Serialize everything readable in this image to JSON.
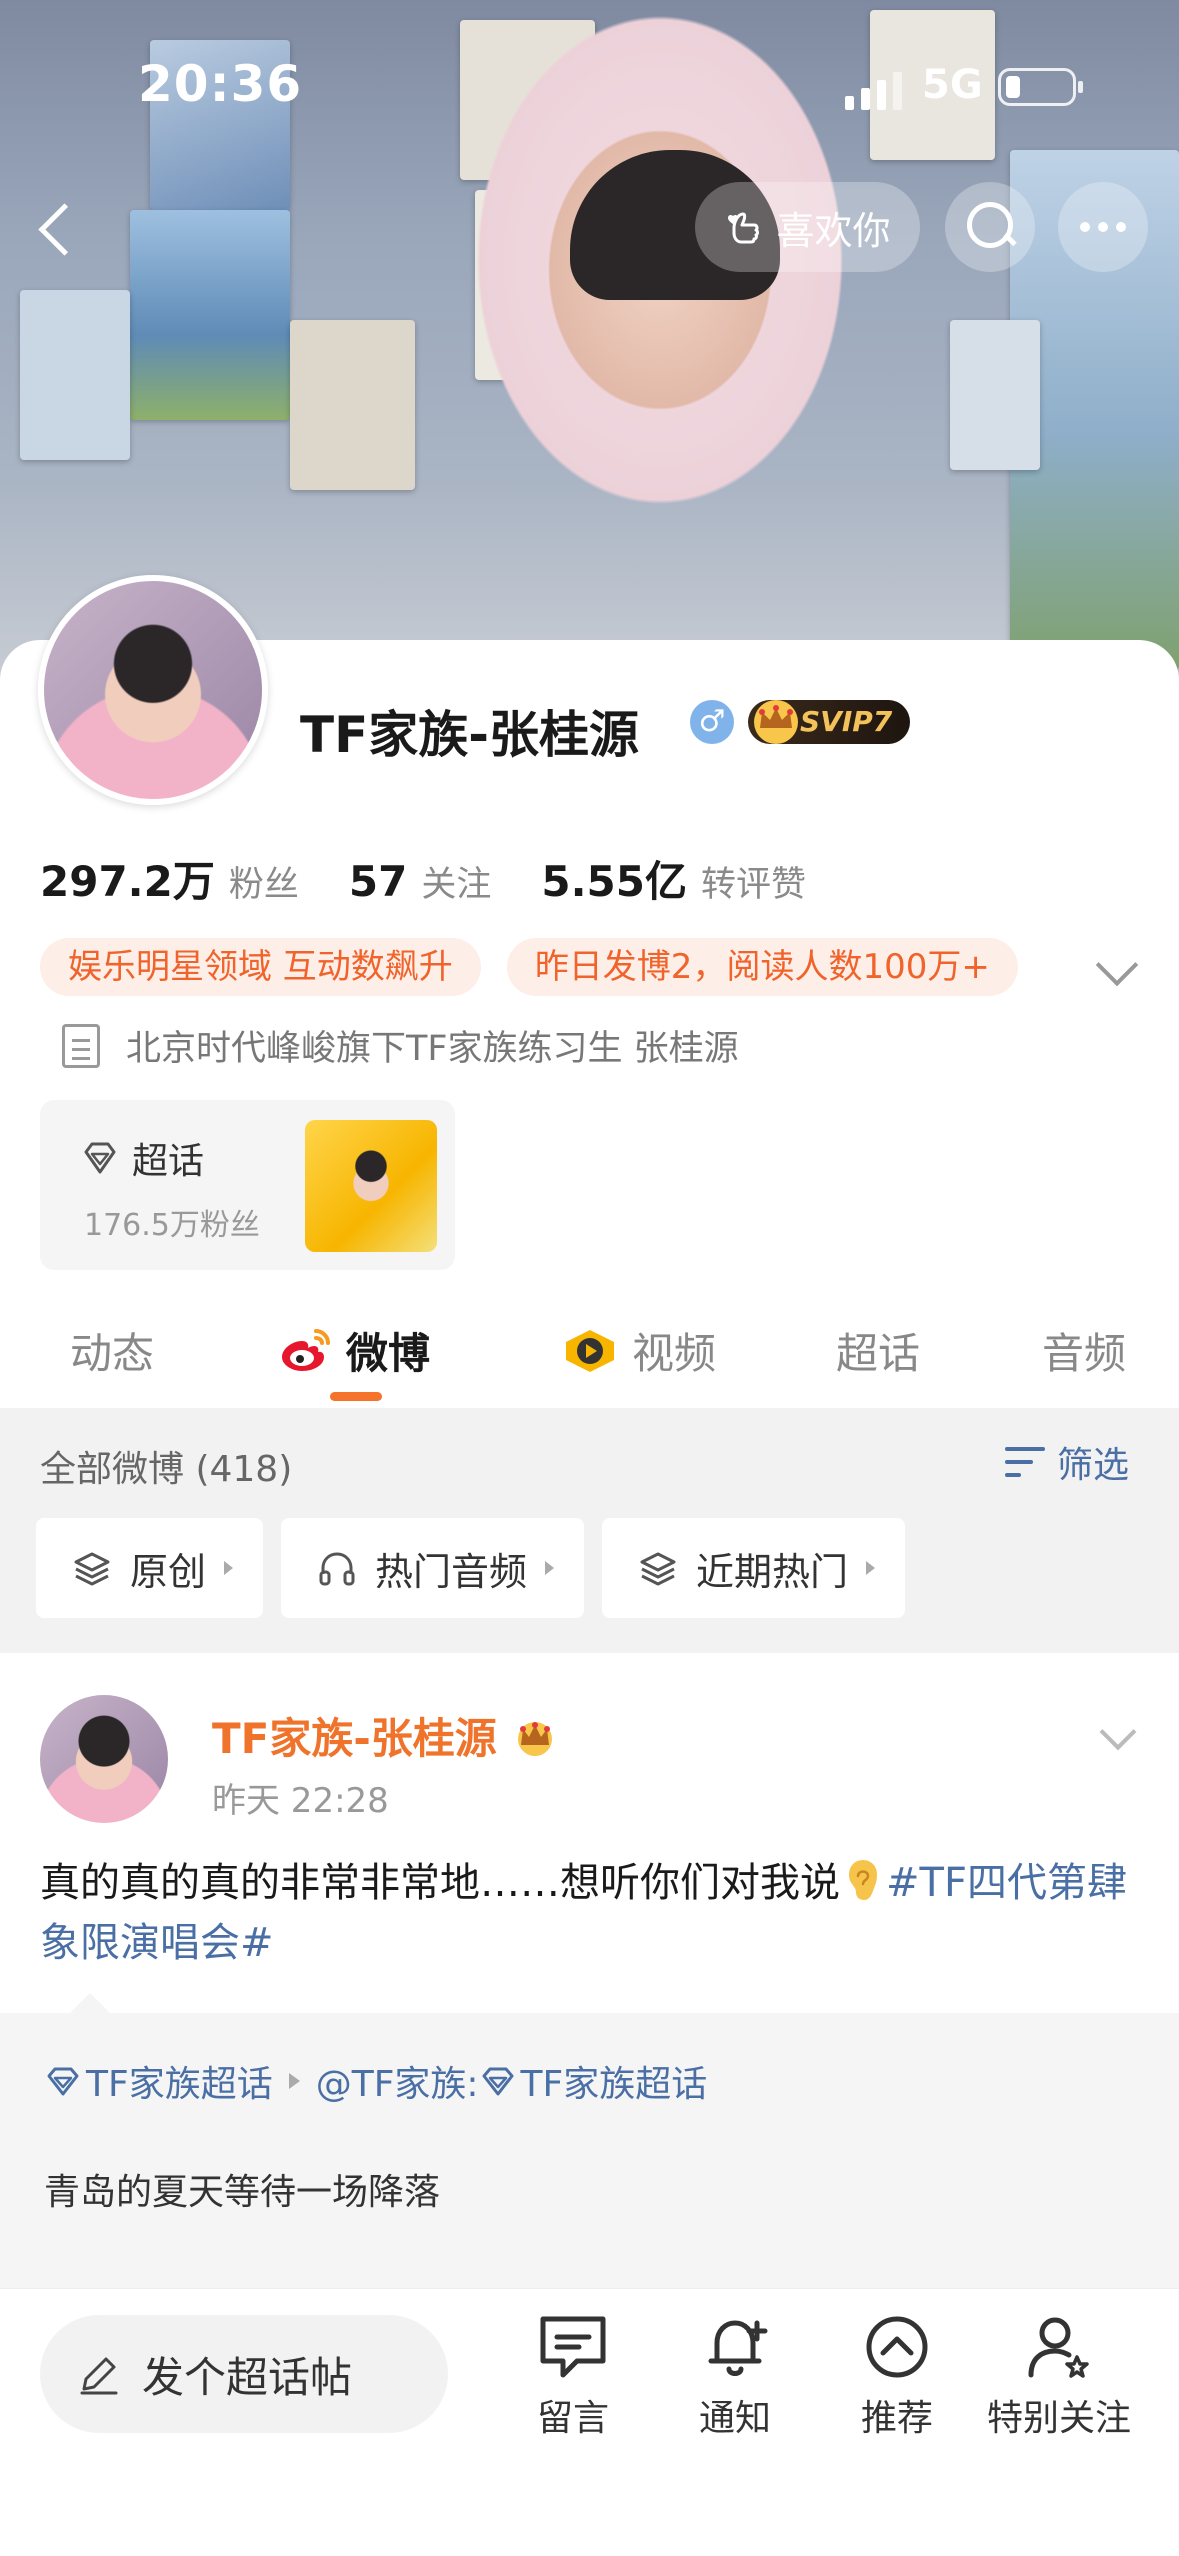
{
  "status_bar": {
    "time": "20:36",
    "network": "5G"
  },
  "header": {
    "like_label": "喜欢你"
  },
  "profile": {
    "name": "TF家族-张桂源",
    "gender_symbol": "♂",
    "svip_label": "SVIP7",
    "stats": [
      {
        "value": "297.2万",
        "label": "粉丝"
      },
      {
        "value": "57",
        "label": "关注"
      },
      {
        "value": "5.55亿",
        "label": "转评赞"
      }
    ],
    "tags": [
      "娱乐明星领域 互动数飙升",
      "昨日发博2，阅读人数100万+"
    ],
    "bio": "北京时代峰峻旗下TF家族练习生  张桂源",
    "super_topic": {
      "title": "超话",
      "fans": "176.5万粉丝"
    }
  },
  "tabs": [
    {
      "label": "动态",
      "icon": ""
    },
    {
      "label": "微博",
      "icon": "weibo-icon"
    },
    {
      "label": "视频",
      "icon": "video-icon"
    },
    {
      "label": "超话",
      "icon": ""
    },
    {
      "label": "音频",
      "icon": ""
    }
  ],
  "filters": {
    "all_posts": "全部微博 (418)",
    "filter_label": "筛选",
    "chips": [
      "原创",
      "热门音频",
      "近期热门"
    ]
  },
  "post": {
    "author": "TF家族-张桂源",
    "time": "昨天 22:28",
    "text_before": "真的真的真的非常非常地……想听你们对我说",
    "hashtag": "#TF四代第肆象限演唱会#"
  },
  "repost": {
    "source_topic": "TF家族超话",
    "mention": "@TF家族:",
    "mention_topic": "TF家族超话",
    "text": "青岛的夏天等待一场降落"
  },
  "bottom_bar": {
    "compose_label": "发个超话帖",
    "actions": [
      "留言",
      "通知",
      "推荐",
      "特别关注"
    ]
  },
  "colors": {
    "accent": "#f5732b",
    "link": "#4a6fa5",
    "tag_bg": "#fdeee8",
    "tag_text": "#f0632b"
  }
}
